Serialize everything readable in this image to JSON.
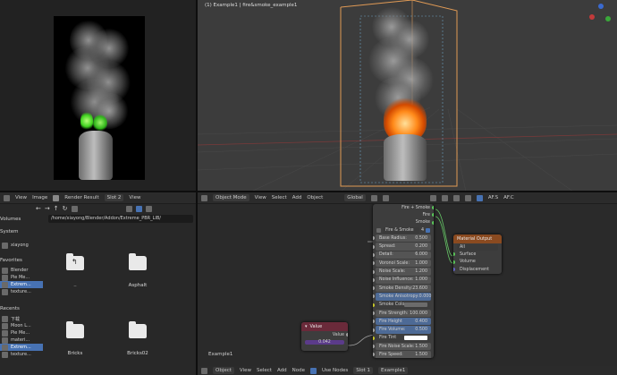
{
  "render_window": {
    "header": {
      "menus": [
        "View",
        "Image"
      ],
      "title": "Render Result",
      "slot": "Slot 2",
      "view": "View"
    }
  },
  "viewport": {
    "title": "(1) Example1 | fire&smoke_example1",
    "header": {
      "mode": "Object Mode",
      "menus": [
        "View",
        "Select",
        "Add",
        "Object"
      ],
      "orientation": "Global",
      "right_labels": [
        "AF.S",
        "AF.C"
      ]
    }
  },
  "file_browser": {
    "path": "/home/xiayong/Blender/Addon/Extreme_PBR_LIB/",
    "sidebar": {
      "volumes_title": "Volumes",
      "system_title": "System",
      "system_items": [
        "xiayong"
      ],
      "favorites_title": "Favorites",
      "favorites_items": [
        "Blender",
        "Pie Me...",
        "Extrem...",
        "texture..."
      ],
      "recents_title": "Recents",
      "recents_items": [
        "下载",
        "Moon L...",
        "Pie Me...",
        "materi...",
        "Extrem...",
        "texture..."
      ]
    },
    "items": [
      {
        "name": "..",
        "kind": "parent"
      },
      {
        "name": "Asphalt",
        "kind": "folder"
      },
      {
        "name": "Bricks",
        "kind": "folder"
      },
      {
        "name": "Bricks02",
        "kind": "folder"
      }
    ]
  },
  "node_editor": {
    "header": {
      "mode": "Object",
      "menus": [
        "View",
        "Select",
        "Add",
        "Node"
      ],
      "checkbox": "Use Nodes",
      "slot": "Slot 1",
      "material": "Example1"
    },
    "material_label": "Example1",
    "fire_smoke_node": {
      "outputs": [
        "Fire + Smoke",
        "Fire",
        "Smoke"
      ],
      "title": "Fire & Smoke",
      "user_count": "4",
      "params": [
        {
          "label": "Base Radius:",
          "value": "0.500"
        },
        {
          "label": "Spread:",
          "value": "0.200"
        },
        {
          "label": "Detail:",
          "value": "6.000"
        },
        {
          "label": "Voronoi Scale:",
          "value": "1.000"
        },
        {
          "label": "Noise Scale:",
          "value": "1.200"
        },
        {
          "label": "Noise Influence:",
          "value": "1.000"
        },
        {
          "label": "Smoke Density:",
          "value": "23.600"
        },
        {
          "label": "Smoke Anisotropy:",
          "value": "0.000",
          "highlight": true
        },
        {
          "label": "Smoke Colo",
          "value": "",
          "swatch": "#6b6b6b"
        },
        {
          "label": "Fire Strength:",
          "value": "100.000"
        },
        {
          "label": "Fire Height",
          "value": "0.400",
          "highlight": true
        },
        {
          "label": "Fire Volume:",
          "value": "0.500",
          "highlight": true
        },
        {
          "label": "Fire Tint",
          "value": "",
          "swatch": "#ffffff"
        },
        {
          "label": "Fire Noise Scale:",
          "value": "1.500"
        },
        {
          "label": "Fire Speed:",
          "value": "1.500"
        },
        {
          "label": "Time",
          "value": ""
        }
      ]
    },
    "material_output_node": {
      "title": "Material Output",
      "target": "All",
      "inputs": [
        "Surface",
        "Volume",
        "Displacement"
      ]
    },
    "value_node": {
      "title": "Value",
      "output": "Value",
      "value": "0.042"
    }
  },
  "colors": {
    "accent": "#4772b3",
    "fire": "#ff7a1a",
    "green_fire": "#4cd62a",
    "value_node": "#6a2a3a",
    "output_node": "#8a4a20",
    "group_node": "#3b3b3b"
  }
}
